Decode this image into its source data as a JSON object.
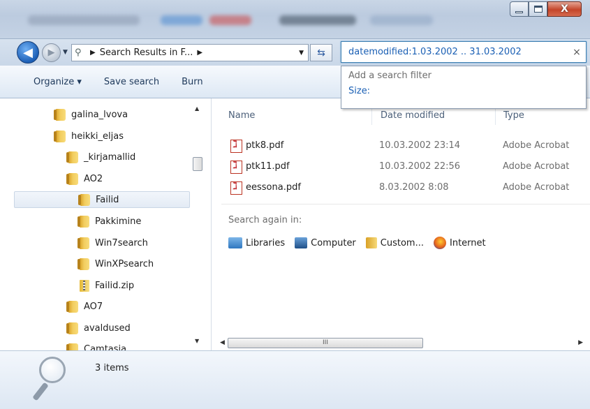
{
  "window": {
    "controls": {
      "minimize_icon": "minimize-icon",
      "maximize_icon": "maximize-icon",
      "close_label": "X"
    }
  },
  "nav": {
    "back_icon": "back-arrow-icon",
    "forward_icon": "forward-arrow-icon",
    "address_text": "Search Results in F...",
    "refresh_icon": "refresh-icon"
  },
  "search": {
    "query": "datemodified:1.03.2002 .. 31.03.2002",
    "clear_label": "×",
    "dropdown_hint": "Add a search filter",
    "filter_size": "Size:"
  },
  "toolbar": {
    "organize_label": "Organize ▾",
    "save_search_label": "Save search",
    "burn_label": "Burn"
  },
  "tree": {
    "items": [
      {
        "label": "galina_lvova",
        "icon": "folder-icon"
      },
      {
        "label": "heikki_eljas",
        "icon": "folder-icon"
      },
      {
        "label": "_kirjamallid",
        "icon": "folder-icon"
      },
      {
        "label": "AO2",
        "icon": "folder-icon"
      },
      {
        "label": "Failid",
        "icon": "folder-icon",
        "selected": true
      },
      {
        "label": "Pakkimine",
        "icon": "folder-icon"
      },
      {
        "label": "Win7search",
        "icon": "folder-icon"
      },
      {
        "label": "WinXPsearch",
        "icon": "folder-icon"
      },
      {
        "label": "Failid.zip",
        "icon": "zip-folder-icon"
      },
      {
        "label": "AO7",
        "icon": "folder-icon"
      },
      {
        "label": "avaldused",
        "icon": "folder-icon"
      },
      {
        "label": "Camtasia",
        "icon": "folder-icon"
      }
    ]
  },
  "columns": {
    "name": "Name",
    "date": "Date modified",
    "type": "Type"
  },
  "files": [
    {
      "name": "ptk8.pdf",
      "date": "10.03.2002 23:14",
      "type": "Adobe Acrobat"
    },
    {
      "name": "ptk11.pdf",
      "date": "10.03.2002 22:56",
      "type": "Adobe Acrobat"
    },
    {
      "name": "eessona.pdf",
      "date": "8.03.2002 8:08",
      "type": "Adobe Acrobat"
    }
  ],
  "search_again": {
    "label": "Search again in:",
    "places": [
      {
        "label": "Libraries",
        "icon": "libraries-icon"
      },
      {
        "label": "Computer",
        "icon": "computer-icon"
      },
      {
        "label": "Custom...",
        "icon": "custom-folder-icon"
      },
      {
        "label": "Internet",
        "icon": "internet-icon"
      }
    ]
  },
  "scrollbars": {
    "h_thumb_grip": "III"
  },
  "details": {
    "count": "3 items"
  },
  "colors": {
    "accent_link": "#1a5fb4",
    "selection": "#e3ebf5"
  }
}
